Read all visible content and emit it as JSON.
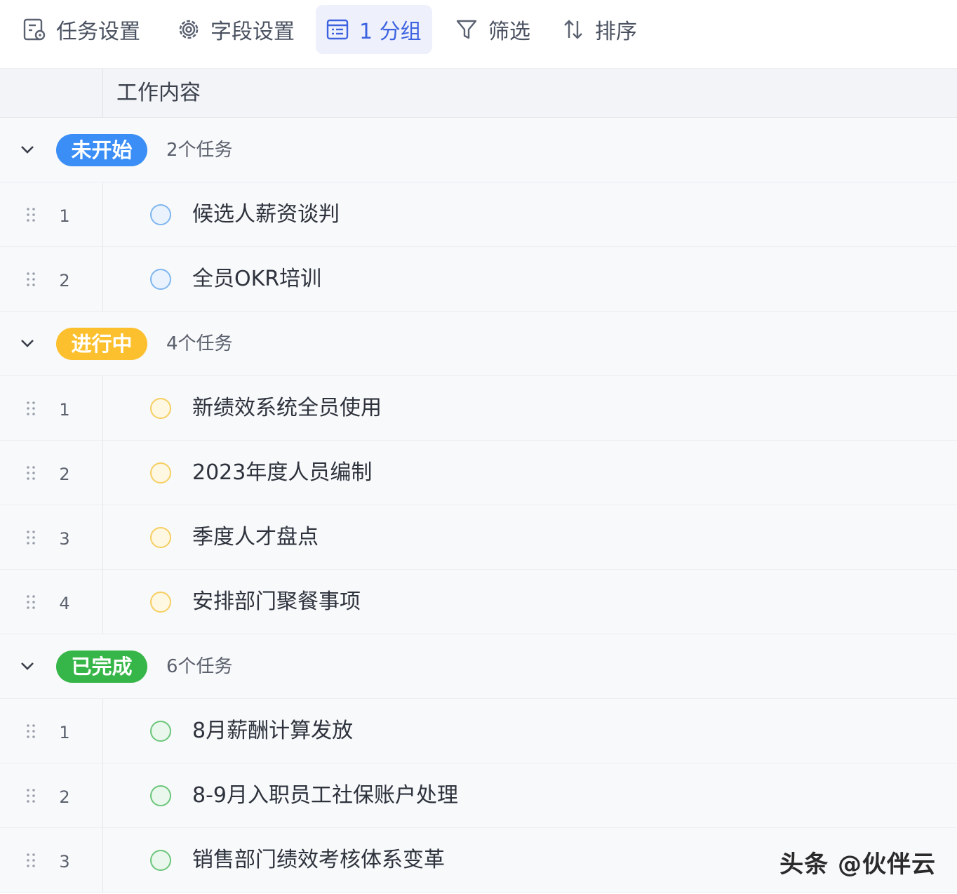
{
  "toolbar": {
    "task_settings": "任务设置",
    "field_settings": "字段设置",
    "group": "1 分组",
    "filter": "筛选",
    "sort": "排序"
  },
  "table": {
    "column_title": "工作内容"
  },
  "colors": {
    "not_started": "#3a8ef6",
    "in_progress": "#fcc02e",
    "done": "#36b648",
    "active_accent": "#3d63e0"
  },
  "groups": [
    {
      "status": "未开始",
      "count": "2个任务",
      "tasks": [
        {
          "index": "1",
          "title": "候选人薪资谈判"
        },
        {
          "index": "2",
          "title": "全员OKR培训"
        }
      ]
    },
    {
      "status": "进行中",
      "count": "4个任务",
      "tasks": [
        {
          "index": "1",
          "title": "新绩效系统全员使用"
        },
        {
          "index": "2",
          "title": "2023年度人员编制"
        },
        {
          "index": "3",
          "title": "季度人才盘点"
        },
        {
          "index": "4",
          "title": "安排部门聚餐事项"
        }
      ]
    },
    {
      "status": "已完成",
      "count": "6个任务",
      "tasks": [
        {
          "index": "1",
          "title": "8月薪酬计算发放"
        },
        {
          "index": "2",
          "title": "8-9月入职员工社保账户处理"
        },
        {
          "index": "3",
          "title": "销售部门绩效考核体系变革"
        }
      ]
    }
  ],
  "watermark": "头条 @伙伴云"
}
